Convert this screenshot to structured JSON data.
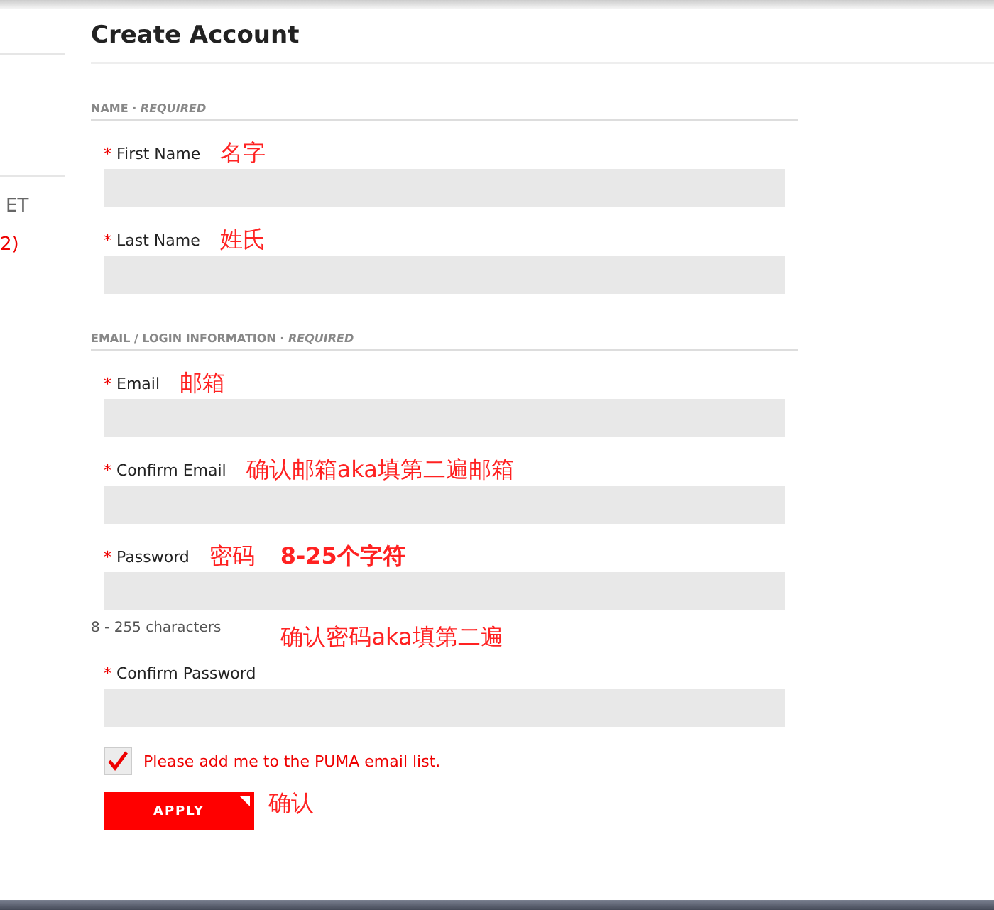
{
  "sidebar": {
    "items": [
      {
        "text": "ET",
        "kind": "plain"
      },
      {
        "text": "2)",
        "kind": "alert"
      }
    ]
  },
  "title": "Create Account",
  "sections": [
    {
      "heading": "NAME · *REQUIRED*",
      "fields": [
        {
          "marker": "*",
          "label": "First Name",
          "annotations": [
            "名字"
          ]
        },
        {
          "marker": "*",
          "label": "Last Name",
          "annotations": [
            "姓氏"
          ]
        }
      ]
    },
    {
      "heading": "EMAIL / LOGIN INFORMATION · *REQUIRED*",
      "fields": [
        {
          "marker": "*",
          "label": "Email",
          "annotations": [
            "邮箱"
          ]
        },
        {
          "marker": "*",
          "label": "Confirm Email",
          "annotations": [
            "确认邮箱aka填第二遍邮箱"
          ]
        },
        {
          "marker": "*",
          "label": "Password",
          "annotations": [
            "密码",
            "8-25个字符"
          ],
          "note": "8 - 255 characters",
          "note_annotation": "确认密码aka填第二遍"
        },
        {
          "marker": "*",
          "label": "Confirm Password"
        }
      ]
    }
  ],
  "checkbox": {
    "label": "Please add me to the PUMA email list.",
    "checked": true
  },
  "button": {
    "label": "APPLY",
    "annotation": "确认"
  }
}
